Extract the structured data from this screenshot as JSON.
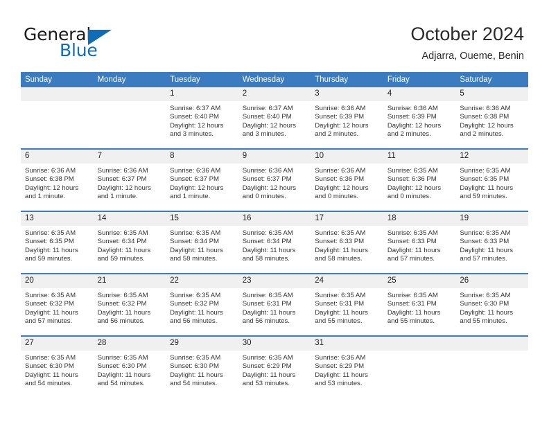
{
  "brand": {
    "name_part1": "General",
    "name_part2": "Blue",
    "accent_color": "#0f6cb6",
    "triangle_icon": "triangle-icon"
  },
  "header": {
    "title": "October 2024",
    "location": "Adjarra, Oueme, Benin"
  },
  "theme": {
    "header_blue": "#3b7cc0",
    "date_band": "#f0f0f0",
    "text": "#333333"
  },
  "weekdays": [
    "Sunday",
    "Monday",
    "Tuesday",
    "Wednesday",
    "Thursday",
    "Friday",
    "Saturday"
  ],
  "labels": {
    "sunrise_prefix": "Sunrise:",
    "sunset_prefix": "Sunset:",
    "daylight_prefix": "Daylight:"
  },
  "weeks": [
    [
      {
        "day": "",
        "l1": "",
        "l2": "",
        "l3": "",
        "l4": ""
      },
      {
        "day": "",
        "l1": "",
        "l2": "",
        "l3": "",
        "l4": ""
      },
      {
        "day": "1",
        "l1": "Sunrise: 6:37 AM",
        "l2": "Sunset: 6:40 PM",
        "l3": "Daylight: 12 hours",
        "l4": "and 3 minutes."
      },
      {
        "day": "2",
        "l1": "Sunrise: 6:37 AM",
        "l2": "Sunset: 6:40 PM",
        "l3": "Daylight: 12 hours",
        "l4": "and 3 minutes."
      },
      {
        "day": "3",
        "l1": "Sunrise: 6:36 AM",
        "l2": "Sunset: 6:39 PM",
        "l3": "Daylight: 12 hours",
        "l4": "and 2 minutes."
      },
      {
        "day": "4",
        "l1": "Sunrise: 6:36 AM",
        "l2": "Sunset: 6:39 PM",
        "l3": "Daylight: 12 hours",
        "l4": "and 2 minutes."
      },
      {
        "day": "5",
        "l1": "Sunrise: 6:36 AM",
        "l2": "Sunset: 6:38 PM",
        "l3": "Daylight: 12 hours",
        "l4": "and 2 minutes."
      }
    ],
    [
      {
        "day": "6",
        "l1": "Sunrise: 6:36 AM",
        "l2": "Sunset: 6:38 PM",
        "l3": "Daylight: 12 hours",
        "l4": "and 1 minute."
      },
      {
        "day": "7",
        "l1": "Sunrise: 6:36 AM",
        "l2": "Sunset: 6:37 PM",
        "l3": "Daylight: 12 hours",
        "l4": "and 1 minute."
      },
      {
        "day": "8",
        "l1": "Sunrise: 6:36 AM",
        "l2": "Sunset: 6:37 PM",
        "l3": "Daylight: 12 hours",
        "l4": "and 1 minute."
      },
      {
        "day": "9",
        "l1": "Sunrise: 6:36 AM",
        "l2": "Sunset: 6:37 PM",
        "l3": "Daylight: 12 hours",
        "l4": "and 0 minutes."
      },
      {
        "day": "10",
        "l1": "Sunrise: 6:36 AM",
        "l2": "Sunset: 6:36 PM",
        "l3": "Daylight: 12 hours",
        "l4": "and 0 minutes."
      },
      {
        "day": "11",
        "l1": "Sunrise: 6:35 AM",
        "l2": "Sunset: 6:36 PM",
        "l3": "Daylight: 12 hours",
        "l4": "and 0 minutes."
      },
      {
        "day": "12",
        "l1": "Sunrise: 6:35 AM",
        "l2": "Sunset: 6:35 PM",
        "l3": "Daylight: 11 hours",
        "l4": "and 59 minutes."
      }
    ],
    [
      {
        "day": "13",
        "l1": "Sunrise: 6:35 AM",
        "l2": "Sunset: 6:35 PM",
        "l3": "Daylight: 11 hours",
        "l4": "and 59 minutes."
      },
      {
        "day": "14",
        "l1": "Sunrise: 6:35 AM",
        "l2": "Sunset: 6:34 PM",
        "l3": "Daylight: 11 hours",
        "l4": "and 59 minutes."
      },
      {
        "day": "15",
        "l1": "Sunrise: 6:35 AM",
        "l2": "Sunset: 6:34 PM",
        "l3": "Daylight: 11 hours",
        "l4": "and 58 minutes."
      },
      {
        "day": "16",
        "l1": "Sunrise: 6:35 AM",
        "l2": "Sunset: 6:34 PM",
        "l3": "Daylight: 11 hours",
        "l4": "and 58 minutes."
      },
      {
        "day": "17",
        "l1": "Sunrise: 6:35 AM",
        "l2": "Sunset: 6:33 PM",
        "l3": "Daylight: 11 hours",
        "l4": "and 58 minutes."
      },
      {
        "day": "18",
        "l1": "Sunrise: 6:35 AM",
        "l2": "Sunset: 6:33 PM",
        "l3": "Daylight: 11 hours",
        "l4": "and 57 minutes."
      },
      {
        "day": "19",
        "l1": "Sunrise: 6:35 AM",
        "l2": "Sunset: 6:33 PM",
        "l3": "Daylight: 11 hours",
        "l4": "and 57 minutes."
      }
    ],
    [
      {
        "day": "20",
        "l1": "Sunrise: 6:35 AM",
        "l2": "Sunset: 6:32 PM",
        "l3": "Daylight: 11 hours",
        "l4": "and 57 minutes."
      },
      {
        "day": "21",
        "l1": "Sunrise: 6:35 AM",
        "l2": "Sunset: 6:32 PM",
        "l3": "Daylight: 11 hours",
        "l4": "and 56 minutes."
      },
      {
        "day": "22",
        "l1": "Sunrise: 6:35 AM",
        "l2": "Sunset: 6:32 PM",
        "l3": "Daylight: 11 hours",
        "l4": "and 56 minutes."
      },
      {
        "day": "23",
        "l1": "Sunrise: 6:35 AM",
        "l2": "Sunset: 6:31 PM",
        "l3": "Daylight: 11 hours",
        "l4": "and 56 minutes."
      },
      {
        "day": "24",
        "l1": "Sunrise: 6:35 AM",
        "l2": "Sunset: 6:31 PM",
        "l3": "Daylight: 11 hours",
        "l4": "and 55 minutes."
      },
      {
        "day": "25",
        "l1": "Sunrise: 6:35 AM",
        "l2": "Sunset: 6:31 PM",
        "l3": "Daylight: 11 hours",
        "l4": "and 55 minutes."
      },
      {
        "day": "26",
        "l1": "Sunrise: 6:35 AM",
        "l2": "Sunset: 6:30 PM",
        "l3": "Daylight: 11 hours",
        "l4": "and 55 minutes."
      }
    ],
    [
      {
        "day": "27",
        "l1": "Sunrise: 6:35 AM",
        "l2": "Sunset: 6:30 PM",
        "l3": "Daylight: 11 hours",
        "l4": "and 54 minutes."
      },
      {
        "day": "28",
        "l1": "Sunrise: 6:35 AM",
        "l2": "Sunset: 6:30 PM",
        "l3": "Daylight: 11 hours",
        "l4": "and 54 minutes."
      },
      {
        "day": "29",
        "l1": "Sunrise: 6:35 AM",
        "l2": "Sunset: 6:30 PM",
        "l3": "Daylight: 11 hours",
        "l4": "and 54 minutes."
      },
      {
        "day": "30",
        "l1": "Sunrise: 6:35 AM",
        "l2": "Sunset: 6:29 PM",
        "l3": "Daylight: 11 hours",
        "l4": "and 53 minutes."
      },
      {
        "day": "31",
        "l1": "Sunrise: 6:36 AM",
        "l2": "Sunset: 6:29 PM",
        "l3": "Daylight: 11 hours",
        "l4": "and 53 minutes."
      },
      {
        "day": "",
        "l1": "",
        "l2": "",
        "l3": "",
        "l4": ""
      },
      {
        "day": "",
        "l1": "",
        "l2": "",
        "l3": "",
        "l4": ""
      }
    ]
  ]
}
